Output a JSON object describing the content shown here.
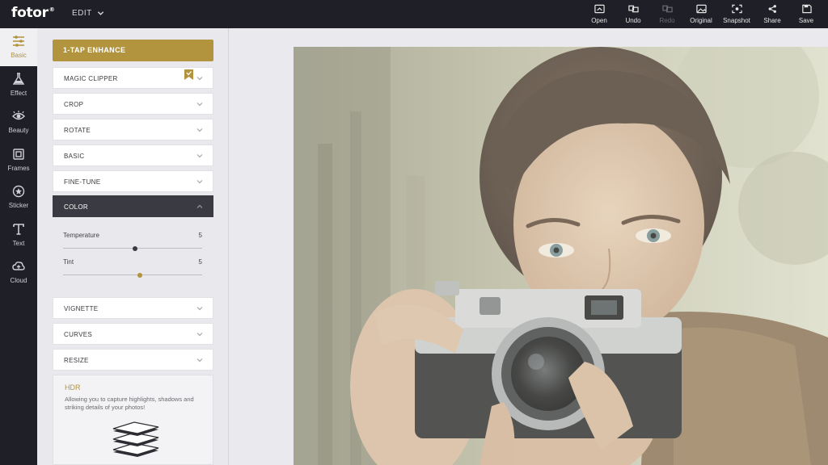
{
  "app": {
    "logo": "fotor",
    "logo_mark": "®",
    "menu": "EDIT"
  },
  "toolbar": [
    {
      "label": "Open",
      "icon": "folder-icon",
      "enabled": true
    },
    {
      "label": "Undo",
      "icon": "undo-icon",
      "enabled": true
    },
    {
      "label": "Redo",
      "icon": "redo-icon",
      "enabled": false
    },
    {
      "label": "Original",
      "icon": "image-icon",
      "enabled": true
    },
    {
      "label": "Snapshot",
      "icon": "snapshot-icon",
      "enabled": true
    },
    {
      "label": "Share",
      "icon": "share-icon",
      "enabled": true
    },
    {
      "label": "Save",
      "icon": "save-icon",
      "enabled": true
    }
  ],
  "sidebar": [
    {
      "label": "Basic",
      "icon": "sliders-icon",
      "active": true
    },
    {
      "label": "Effect",
      "icon": "flask-icon",
      "active": false
    },
    {
      "label": "Beauty",
      "icon": "eye-icon",
      "active": false
    },
    {
      "label": "Frames",
      "icon": "frame-icon",
      "active": false
    },
    {
      "label": "Sticker",
      "icon": "star-icon",
      "active": false
    },
    {
      "label": "Text",
      "icon": "text-icon",
      "active": false
    },
    {
      "label": "Cloud",
      "icon": "cloud-icon",
      "active": false
    }
  ],
  "panel": {
    "enhance": "1-TAP ENHANCE",
    "sections": [
      {
        "label": "MAGIC CLIPPER",
        "open": false,
        "bookmark": true
      },
      {
        "label": "CROP",
        "open": false
      },
      {
        "label": "ROTATE",
        "open": false
      },
      {
        "label": "BASIC",
        "open": false
      },
      {
        "label": "FINE-TUNE",
        "open": false
      },
      {
        "label": "COLOR",
        "open": true
      }
    ],
    "color_sliders": [
      {
        "label": "Temperature",
        "value": "5",
        "fraction": 0.52
      },
      {
        "label": "Tint",
        "value": "5",
        "fraction": 0.55
      }
    ],
    "sections_after": [
      {
        "label": "VIGNETTE"
      },
      {
        "label": "CURVES"
      },
      {
        "label": "RESIZE"
      }
    ],
    "hdr": {
      "title": "HDR",
      "description": "Allowing you to capture highlights, shadows and striking details of your photos!"
    }
  },
  "colors": {
    "accent": "#b3943e",
    "dark": "#1f1f28",
    "panel": "#e9e9ed",
    "knob_dark": "#3a3a42",
    "knob_gold": "#b3943e"
  }
}
